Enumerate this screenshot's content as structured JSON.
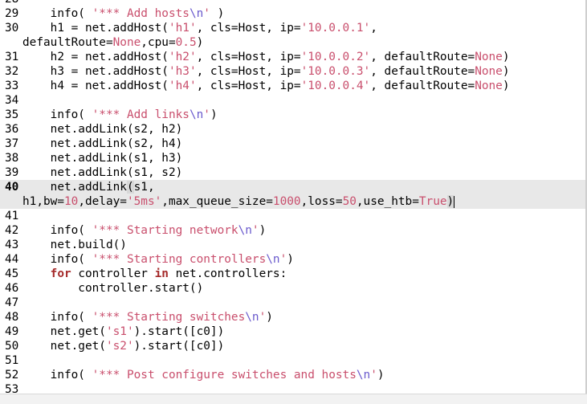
{
  "editor": {
    "first_partial_line": "28",
    "lines": [
      {
        "num": "29",
        "text": "    info( '*** Add hosts\\n' )"
      },
      {
        "num": "30",
        "text": "    h1 = net.addHost('h1', cls=Host, ip='10.0.0.1',",
        "wrap": "defaultRoute=None,cpu=0.5)"
      },
      {
        "num": "31",
        "text": "    h2 = net.addHost('h2', cls=Host, ip='10.0.0.2', defaultRoute=None)"
      },
      {
        "num": "32",
        "text": "    h3 = net.addHost('h3', cls=Host, ip='10.0.0.3', defaultRoute=None)"
      },
      {
        "num": "33",
        "text": "    h4 = net.addHost('h4', cls=Host, ip='10.0.0.4', defaultRoute=None)"
      },
      {
        "num": "34",
        "text": ""
      },
      {
        "num": "35",
        "text": "    info( '*** Add links\\n')"
      },
      {
        "num": "36",
        "text": "    net.addLink(s2, h2)"
      },
      {
        "num": "37",
        "text": "    net.addLink(s2, h4)"
      },
      {
        "num": "38",
        "text": "    net.addLink(s1, h3)"
      },
      {
        "num": "39",
        "text": "    net.addLink(s1, s2)"
      },
      {
        "num": "40",
        "text": "    net.addLink(s1,",
        "wrap": "h1,bw=10,delay='5ms',max_queue_size=1000,loss=50,use_htb=True)",
        "current": true
      },
      {
        "num": "41",
        "text": ""
      },
      {
        "num": "42",
        "text": "    info( '*** Starting network\\n')"
      },
      {
        "num": "43",
        "text": "    net.build()"
      },
      {
        "num": "44",
        "text": "    info( '*** Starting controllers\\n')"
      },
      {
        "num": "45",
        "text": "    for controller in net.controllers:"
      },
      {
        "num": "46",
        "text": "        controller.start()"
      },
      {
        "num": "47",
        "text": ""
      },
      {
        "num": "48",
        "text": "    info( '*** Starting switches\\n')"
      },
      {
        "num": "49",
        "text": "    net.get('s1').start([c0])"
      },
      {
        "num": "50",
        "text": "    net.get('s2').start([c0])"
      },
      {
        "num": "51",
        "text": ""
      },
      {
        "num": "52",
        "text": "    info( '*** Post configure switches and hosts\\n')"
      },
      {
        "num": "53",
        "text": ""
      }
    ]
  },
  "colors": {
    "keyword": "#a52a2a",
    "string": "#c94f6d",
    "escape": "#6a5acd",
    "current_line": "#e8e8e8"
  }
}
